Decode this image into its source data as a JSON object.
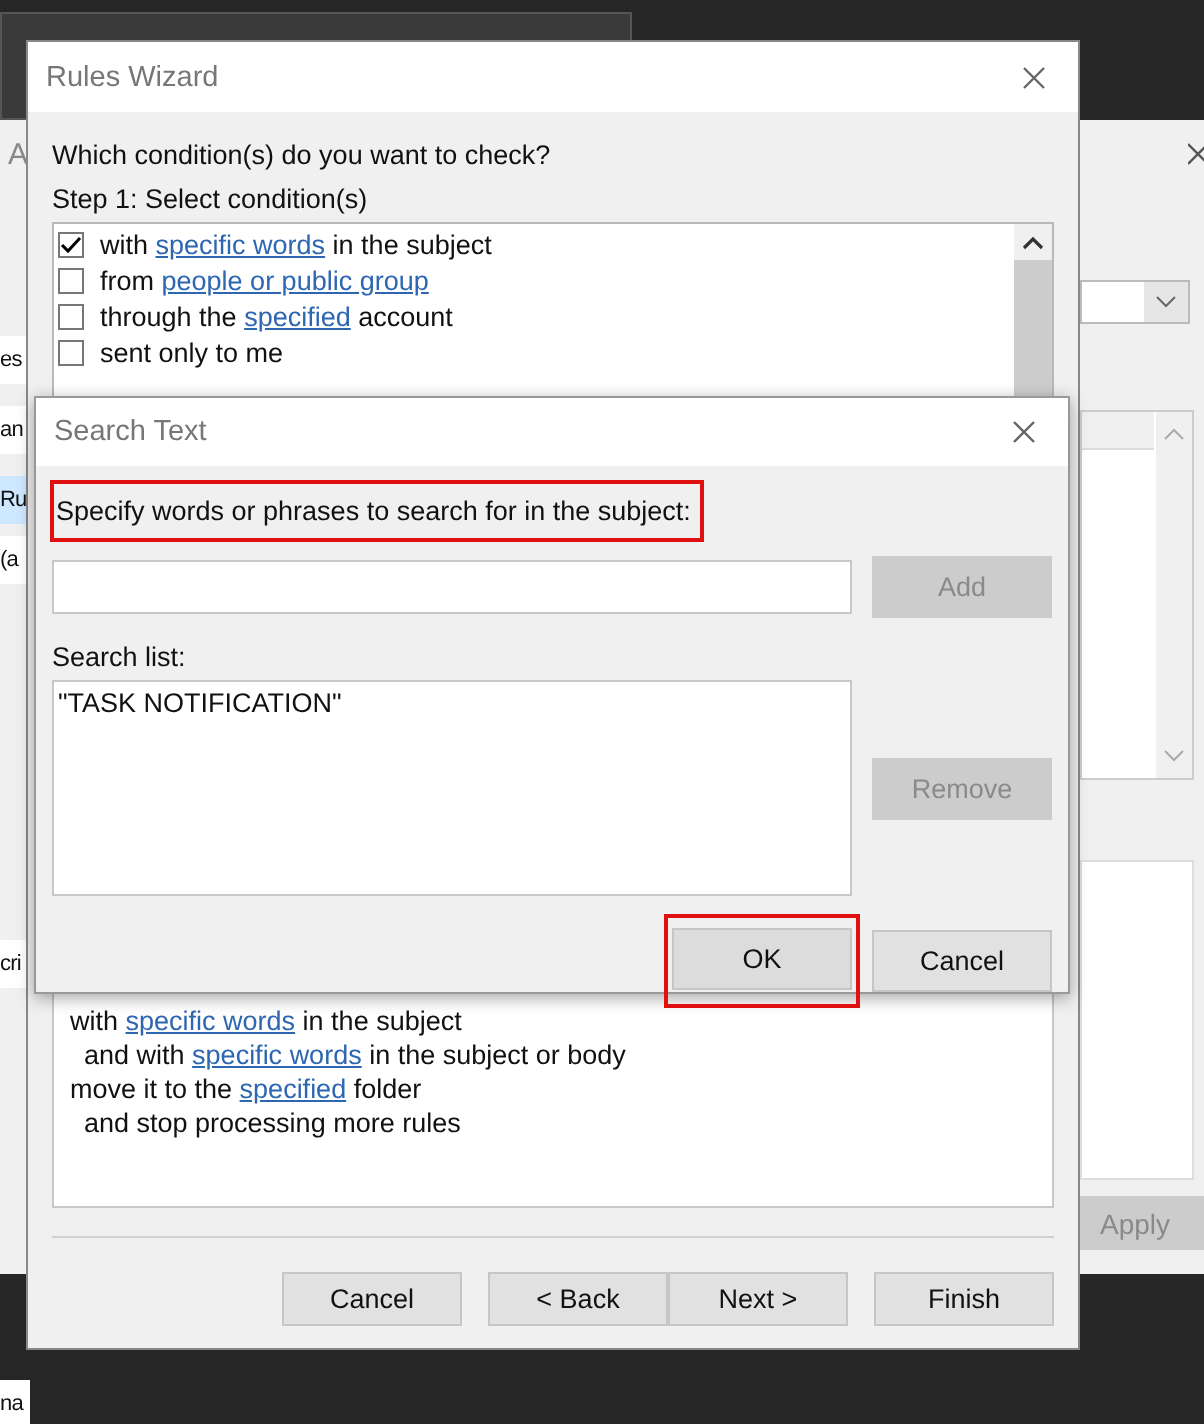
{
  "background_window": {
    "title_fragment": "A",
    "left_fragments": [
      {
        "text": "es",
        "selected": false
      },
      {
        "text": "an",
        "selected": false
      },
      {
        "text": "Ru",
        "selected": true
      },
      {
        "text": "(a",
        "selected": false
      },
      {
        "text": "cri",
        "selected": false
      },
      {
        "text": "na",
        "selected": false
      }
    ],
    "apply_button": {
      "label": "Apply",
      "disabled": true
    }
  },
  "rules_wizard": {
    "title": "Rules Wizard",
    "question": "Which condition(s) do you want to check?",
    "step_label": "Step 1: Select condition(s)",
    "conditions": [
      {
        "checked": true,
        "parts": [
          {
            "kind": "plain",
            "text": "with "
          },
          {
            "kind": "link",
            "text": "specific words"
          },
          {
            "kind": "plain",
            "text": " in the subject"
          }
        ]
      },
      {
        "checked": false,
        "parts": [
          {
            "kind": "plain",
            "text": "from "
          },
          {
            "kind": "link",
            "text": "people or public group"
          }
        ]
      },
      {
        "checked": false,
        "parts": [
          {
            "kind": "plain",
            "text": "through the "
          },
          {
            "kind": "link",
            "text": "specified"
          },
          {
            "kind": "plain",
            "text": " account"
          }
        ]
      },
      {
        "checked": false,
        "parts": [
          {
            "kind": "plain",
            "text": "sent only to me"
          }
        ]
      }
    ],
    "description": [
      {
        "indented": false,
        "parts": [
          {
            "kind": "plain",
            "text": "with "
          },
          {
            "kind": "link",
            "text": "specific words"
          },
          {
            "kind": "plain",
            "text": " in the subject"
          }
        ]
      },
      {
        "indented": true,
        "parts": [
          {
            "kind": "plain",
            "text": "and with "
          },
          {
            "kind": "link",
            "text": "specific words"
          },
          {
            "kind": "plain",
            "text": " in the subject or body"
          }
        ]
      },
      {
        "indented": false,
        "parts": [
          {
            "kind": "plain",
            "text": "move it to the "
          },
          {
            "kind": "link",
            "text": "specified"
          },
          {
            "kind": "plain",
            "text": " folder"
          }
        ]
      },
      {
        "indented": true,
        "parts": [
          {
            "kind": "plain",
            "text": "and stop processing more rules"
          }
        ]
      }
    ],
    "buttons": [
      "Cancel",
      "< Back",
      "Next >",
      "Finish"
    ]
  },
  "search_text_dialog": {
    "title": "Search Text",
    "instruction": {
      "text": "Specify words or phrases to search for in the subject:",
      "highlighted": true
    },
    "add_button": {
      "label": "Add",
      "disabled": true
    },
    "search_list_label": "Search list:",
    "search_list": [
      "\"TASK NOTIFICATION\""
    ],
    "remove_button": {
      "label": "Remove",
      "disabled": true
    },
    "ok_button": {
      "label": "OK",
      "highlighted": true
    },
    "cancel_button": {
      "label": "Cancel"
    }
  }
}
